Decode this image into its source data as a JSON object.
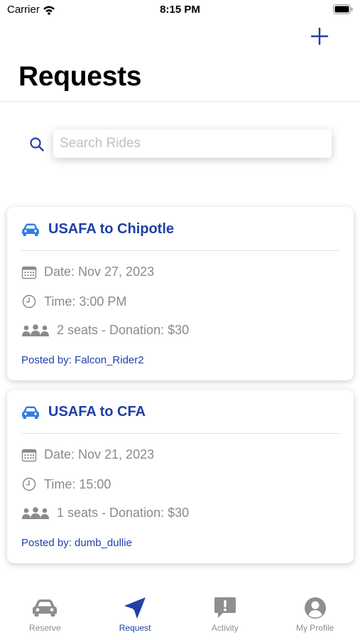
{
  "status_bar": {
    "carrier": "Carrier",
    "time": "8:15 PM"
  },
  "header": {
    "title": "Requests"
  },
  "search": {
    "placeholder": "Search Rides",
    "value": ""
  },
  "rides": [
    {
      "title": "USAFA to Chipotle",
      "date": "Date: Nov 27, 2023",
      "time": "Time: 3:00 PM",
      "seats": "2 seats - Donation: $30",
      "posted_by": "Posted by: Falcon_Rider2"
    },
    {
      "title": "USAFA to CFA",
      "date": "Date: Nov 21, 2023",
      "time": "Time: 15:00",
      "seats": "1 seats - Donation: $30",
      "posted_by": "Posted by: dumb_dullie"
    }
  ],
  "tab_bar": {
    "items": [
      {
        "label": "Reserve",
        "icon": "car-icon"
      },
      {
        "label": "Request",
        "icon": "paper-plane-icon"
      },
      {
        "label": "Activity",
        "icon": "exclamation-bubble-icon"
      },
      {
        "label": "My Profile",
        "icon": "person-circle-icon"
      }
    ],
    "active_index": 1
  },
  "colors": {
    "accent": "#1f3fa8",
    "car_icon": "#2f7fe0",
    "secondary_text": "#8a8a8e",
    "tab_inactive": "#8e8e93"
  }
}
